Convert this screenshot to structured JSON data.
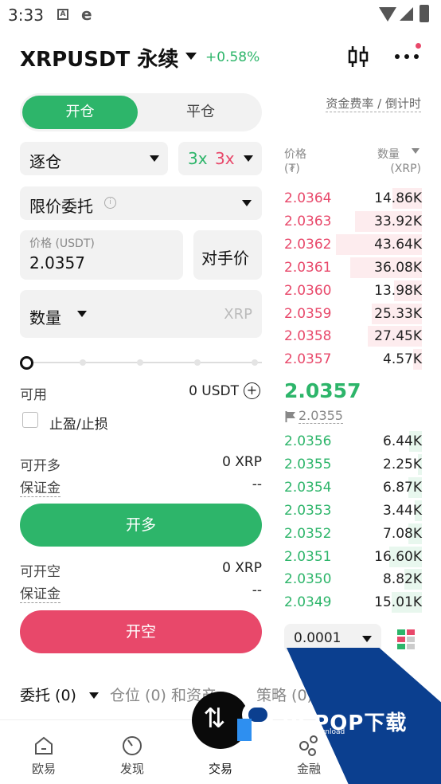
{
  "status": {
    "time": "3:33"
  },
  "header": {
    "pair": "XRPUSDT 永续",
    "change": "+0.58%"
  },
  "colors": {
    "buy": "#2db56a",
    "sell": "#e8486a",
    "watermark": "#0b3f8f"
  },
  "icons": [
    "candlestick-icon",
    "more-icon",
    "info-icon",
    "plus-circle-icon",
    "flag-icon",
    "depth-view-icon",
    "home-icon",
    "discover-icon",
    "trade-icon",
    "finance-icon"
  ],
  "form": {
    "tabs": {
      "open": "开仓",
      "close": "平仓"
    },
    "margin_mode": "逐仓",
    "leverage_long": "3x",
    "leverage_short": "3x",
    "order_type": "限价委托",
    "price_label": "价格 (USDT)",
    "price_value": "2.0357",
    "counterparty_price": "对手价",
    "quantity_label": "数量",
    "quantity_unit": "XRP",
    "available_label": "可用",
    "available_value": "0 USDT",
    "tpsl_label": "止盈/止损",
    "long_avail_label": "可开多",
    "long_avail_value": "0 XRP",
    "long_margin_label": "保证金",
    "long_margin_value": "--",
    "long_button": "开多",
    "short_avail_label": "可开空",
    "short_avail_value": "0 XRP",
    "short_margin_label": "保证金",
    "short_margin_value": "--",
    "short_button": "开空"
  },
  "orderbook": {
    "funding_label": "资金费率 / 倒计时",
    "price_header": "价格",
    "price_unit": "(₮)",
    "qty_header": "数量",
    "qty_unit": "(XRP)",
    "asks": [
      {
        "price": "2.0364",
        "qty": "14.86K",
        "depth": 0.34
      },
      {
        "price": "2.0363",
        "qty": "33.92K",
        "depth": 0.78
      },
      {
        "price": "2.0362",
        "qty": "43.64K",
        "depth": 1.0
      },
      {
        "price": "2.0361",
        "qty": "36.08K",
        "depth": 0.83
      },
      {
        "price": "2.0360",
        "qty": "13.98K",
        "depth": 0.32
      },
      {
        "price": "2.0359",
        "qty": "25.33K",
        "depth": 0.58
      },
      {
        "price": "2.0358",
        "qty": "27.45K",
        "depth": 0.63
      },
      {
        "price": "2.0357",
        "qty": "4.57K",
        "depth": 0.1
      }
    ],
    "last_price": "2.0357",
    "mark_price": "2.0355",
    "bids": [
      {
        "price": "2.0356",
        "qty": "6.44K",
        "depth": 0.15
      },
      {
        "price": "2.0355",
        "qty": "2.25K",
        "depth": 0.05
      },
      {
        "price": "2.0354",
        "qty": "6.87K",
        "depth": 0.16
      },
      {
        "price": "2.0353",
        "qty": "3.44K",
        "depth": 0.08
      },
      {
        "price": "2.0352",
        "qty": "7.08K",
        "depth": 0.16
      },
      {
        "price": "2.0351",
        "qty": "16.60K",
        "depth": 0.38
      },
      {
        "price": "2.0350",
        "qty": "8.82K",
        "depth": 0.2
      },
      {
        "price": "2.0349",
        "qty": "15.01K",
        "depth": 0.35
      }
    ],
    "precision": "0.0001"
  },
  "bottom_tabs": {
    "orders": "委托 (0)",
    "positions": "仓位 (0) 和资产",
    "strategy": "策略 (0)"
  },
  "watermark": {
    "brand": "PCPOP下载",
    "sub": "PCPOP Download"
  },
  "nav": [
    {
      "label": "欧易"
    },
    {
      "label": "发现"
    },
    {
      "label": "交易"
    },
    {
      "label": "金融"
    }
  ]
}
